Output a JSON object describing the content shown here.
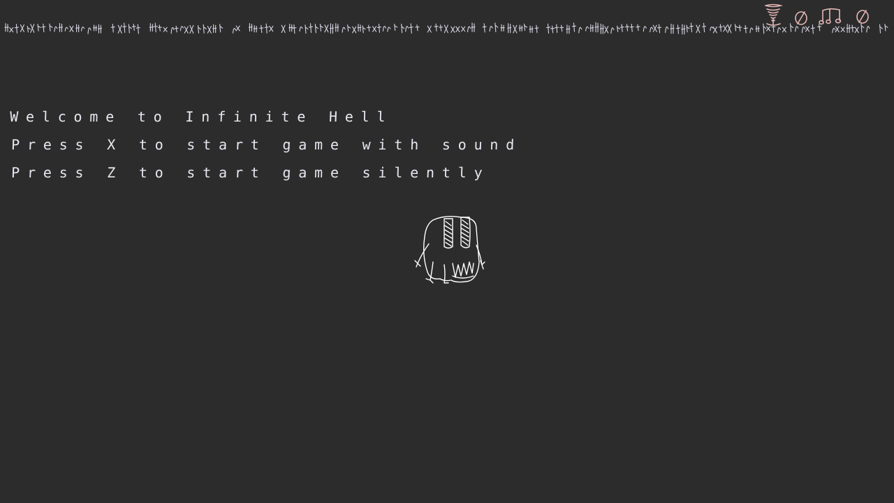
{
  "menu": {
    "welcome": "Welcome to Infinite Hell",
    "start_sound": "Press X to start game with sound",
    "start_silent": "Press Z to start game silently"
  },
  "colors": {
    "background": "#2c2c2c",
    "text": "#e8e6f0",
    "accent_pink": "#e6b7b7"
  },
  "icons": {
    "top_strip": "scribble-glyph-strip",
    "top_right": [
      "tornado-icon",
      "no-symbol-icon",
      "music-notes-icon",
      "no-symbol-icon"
    ]
  },
  "sprite": "creature-sprite"
}
